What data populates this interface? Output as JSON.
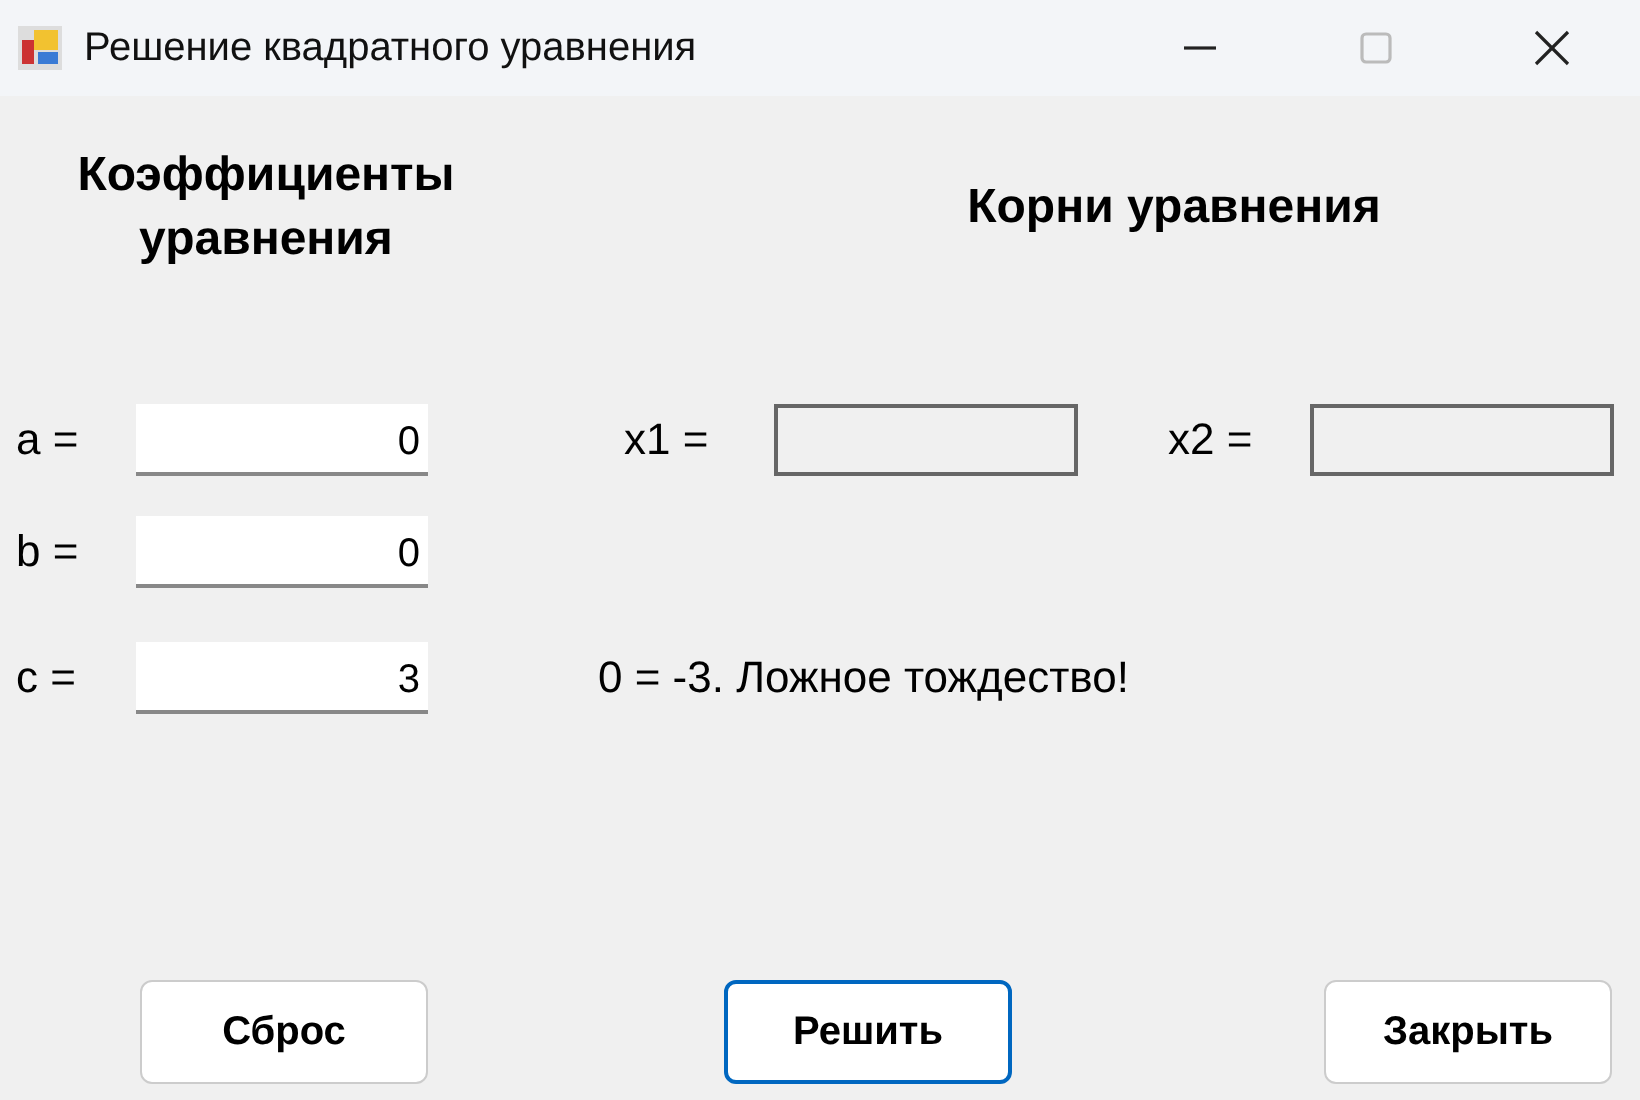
{
  "window": {
    "title": "Решение квадратного уравнения",
    "controls": [
      {
        "kind": "minimize",
        "disabled": false
      },
      {
        "kind": "maximize",
        "disabled": true
      },
      {
        "kind": "close",
        "disabled": false
      }
    ]
  },
  "headings": {
    "coefficients": "Коэффициенты уравнения",
    "roots": "Корни уравнения"
  },
  "coefficients": [
    {
      "label": "a =",
      "value": "0"
    },
    {
      "label": "b =",
      "value": "0"
    },
    {
      "label": "c =",
      "value": "3"
    }
  ],
  "roots": [
    {
      "label": "x1 ="
    },
    {
      "label": "x2 ="
    }
  ],
  "message": "0 = -3. Ложное тождество!",
  "buttons": [
    {
      "label": "Сброс",
      "focused": false
    },
    {
      "label": "Решить",
      "focused": true
    },
    {
      "label": "Закрыть",
      "focused": false
    }
  ]
}
